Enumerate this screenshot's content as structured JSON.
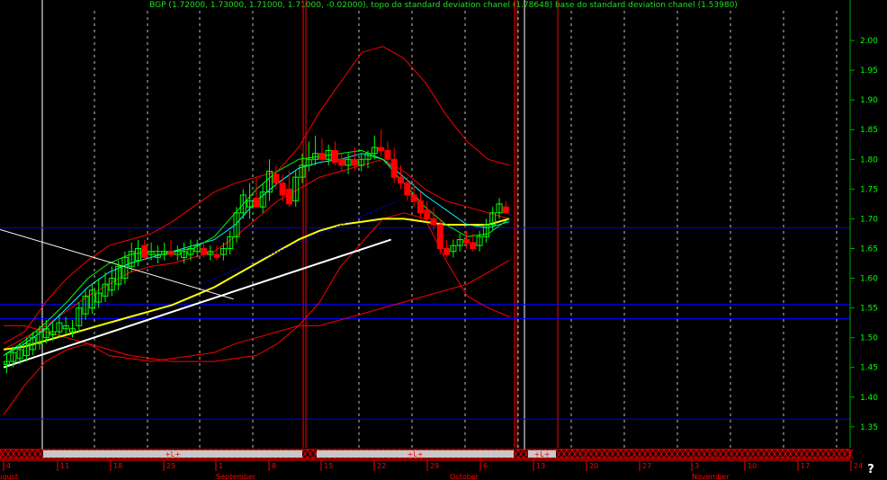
{
  "header": {
    "text": "BGP (1.72000, 1.73000, 1.71000, 1.71000, -0.02000), topo do standard deviation chanel (1.78648) base do standard deviation chanel (1.53980)"
  },
  "colors": {
    "background": "#000000",
    "up_candle": "#00ff00",
    "down_candle": "#ff0000",
    "grid": "#ffffff",
    "axis": "#00aa00",
    "label": "#00ff00",
    "band": "#ff0000",
    "ma_yellow": "#ffff00",
    "ma_cyan": "#00ffff",
    "trend_white": "#ffffff",
    "horizontal_level": "#0000ff",
    "marker_bar": "#c8c8c8"
  },
  "help_label": "?",
  "chart_data": {
    "type": "candlestick",
    "title": "BGP",
    "y_axis": {
      "ticks": [
        "2.00",
        "1.95",
        "1.90",
        "1.85",
        "1.80",
        "1.75",
        "1.70",
        "1.65",
        "1.60",
        "1.55",
        "1.50",
        "1.45",
        "1.40",
        "1.35"
      ],
      "range": [
        1.315,
        2.05
      ]
    },
    "x_axis": {
      "day_labels": [
        "4",
        "11",
        "18",
        "25",
        "1",
        "8",
        "15",
        "22",
        "29",
        "6",
        "13",
        "20",
        "27",
        "3",
        "10",
        "17",
        "24"
      ],
      "month_labels": [
        "August",
        "September",
        "October",
        "November"
      ]
    },
    "marker_labels": [
      "+L+",
      "+L+",
      "+L+"
    ],
    "horizontal_levels": [
      1.685,
      1.556,
      1.532,
      1.363
    ],
    "candles": [
      {
        "o": 1.455,
        "h": 1.475,
        "l": 1.44,
        "c": 1.46
      },
      {
        "o": 1.46,
        "h": 1.485,
        "l": 1.45,
        "c": 1.475
      },
      {
        "o": 1.465,
        "h": 1.49,
        "l": 1.455,
        "c": 1.48
      },
      {
        "o": 1.47,
        "h": 1.5,
        "l": 1.46,
        "c": 1.49
      },
      {
        "o": 1.48,
        "h": 1.51,
        "l": 1.47,
        "c": 1.5
      },
      {
        "o": 1.49,
        "h": 1.52,
        "l": 1.48,
        "c": 1.51
      },
      {
        "o": 1.5,
        "h": 1.53,
        "l": 1.49,
        "c": 1.515
      },
      {
        "o": 1.505,
        "h": 1.525,
        "l": 1.495,
        "c": 1.51
      },
      {
        "o": 1.51,
        "h": 1.54,
        "l": 1.5,
        "c": 1.525
      },
      {
        "o": 1.515,
        "h": 1.535,
        "l": 1.505,
        "c": 1.52
      },
      {
        "o": 1.51,
        "h": 1.53,
        "l": 1.5,
        "c": 1.515
      },
      {
        "o": 1.52,
        "h": 1.56,
        "l": 1.51,
        "c": 1.55
      },
      {
        "o": 1.54,
        "h": 1.58,
        "l": 1.53,
        "c": 1.57
      },
      {
        "o": 1.55,
        "h": 1.59,
        "l": 1.54,
        "c": 1.58
      },
      {
        "o": 1.56,
        "h": 1.6,
        "l": 1.55,
        "c": 1.575
      },
      {
        "o": 1.57,
        "h": 1.61,
        "l": 1.56,
        "c": 1.59
      },
      {
        "o": 1.58,
        "h": 1.62,
        "l": 1.57,
        "c": 1.6
      },
      {
        "o": 1.59,
        "h": 1.63,
        "l": 1.58,
        "c": 1.62
      },
      {
        "o": 1.6,
        "h": 1.645,
        "l": 1.59,
        "c": 1.635
      },
      {
        "o": 1.62,
        "h": 1.66,
        "l": 1.61,
        "c": 1.645
      },
      {
        "o": 1.63,
        "h": 1.665,
        "l": 1.62,
        "c": 1.65
      },
      {
        "o": 1.655,
        "h": 1.665,
        "l": 1.63,
        "c": 1.635
      },
      {
        "o": 1.64,
        "h": 1.66,
        "l": 1.63,
        "c": 1.645
      },
      {
        "o": 1.635,
        "h": 1.655,
        "l": 1.625,
        "c": 1.64
      },
      {
        "o": 1.64,
        "h": 1.66,
        "l": 1.63,
        "c": 1.645
      },
      {
        "o": 1.645,
        "h": 1.665,
        "l": 1.635,
        "c": 1.64
      },
      {
        "o": 1.64,
        "h": 1.655,
        "l": 1.63,
        "c": 1.645
      },
      {
        "o": 1.635,
        "h": 1.66,
        "l": 1.625,
        "c": 1.645
      },
      {
        "o": 1.64,
        "h": 1.665,
        "l": 1.63,
        "c": 1.65
      },
      {
        "o": 1.645,
        "h": 1.665,
        "l": 1.635,
        "c": 1.655
      },
      {
        "o": 1.65,
        "h": 1.66,
        "l": 1.635,
        "c": 1.64
      },
      {
        "o": 1.64,
        "h": 1.655,
        "l": 1.63,
        "c": 1.645
      },
      {
        "o": 1.64,
        "h": 1.655,
        "l": 1.63,
        "c": 1.635
      },
      {
        "o": 1.64,
        "h": 1.66,
        "l": 1.63,
        "c": 1.65
      },
      {
        "o": 1.65,
        "h": 1.68,
        "l": 1.64,
        "c": 1.67
      },
      {
        "o": 1.67,
        "h": 1.72,
        "l": 1.66,
        "c": 1.71
      },
      {
        "o": 1.71,
        "h": 1.75,
        "l": 1.7,
        "c": 1.74
      },
      {
        "o": 1.72,
        "h": 1.76,
        "l": 1.7,
        "c": 1.73
      },
      {
        "o": 1.735,
        "h": 1.77,
        "l": 1.72,
        "c": 1.72
      },
      {
        "o": 1.72,
        "h": 1.76,
        "l": 1.71,
        "c": 1.745
      },
      {
        "o": 1.745,
        "h": 1.8,
        "l": 1.73,
        "c": 1.78
      },
      {
        "o": 1.775,
        "h": 1.79,
        "l": 1.75,
        "c": 1.76
      },
      {
        "o": 1.76,
        "h": 1.775,
        "l": 1.73,
        "c": 1.74
      },
      {
        "o": 1.75,
        "h": 1.78,
        "l": 1.72,
        "c": 1.725
      },
      {
        "o": 1.73,
        "h": 1.78,
        "l": 1.72,
        "c": 1.77
      },
      {
        "o": 1.77,
        "h": 1.81,
        "l": 1.76,
        "c": 1.79
      },
      {
        "o": 1.79,
        "h": 1.83,
        "l": 1.78,
        "c": 1.8
      },
      {
        "o": 1.8,
        "h": 1.84,
        "l": 1.79,
        "c": 1.81
      },
      {
        "o": 1.81,
        "h": 1.835,
        "l": 1.795,
        "c": 1.8
      },
      {
        "o": 1.8,
        "h": 1.825,
        "l": 1.79,
        "c": 1.815
      },
      {
        "o": 1.815,
        "h": 1.83,
        "l": 1.79,
        "c": 1.795
      },
      {
        "o": 1.8,
        "h": 1.81,
        "l": 1.78,
        "c": 1.79
      },
      {
        "o": 1.79,
        "h": 1.81,
        "l": 1.775,
        "c": 1.8
      },
      {
        "o": 1.8,
        "h": 1.82,
        "l": 1.78,
        "c": 1.79
      },
      {
        "o": 1.79,
        "h": 1.81,
        "l": 1.78,
        "c": 1.8
      },
      {
        "o": 1.8,
        "h": 1.815,
        "l": 1.785,
        "c": 1.81
      },
      {
        "o": 1.81,
        "h": 1.84,
        "l": 1.8,
        "c": 1.82
      },
      {
        "o": 1.82,
        "h": 1.85,
        "l": 1.805,
        "c": 1.815
      },
      {
        "o": 1.815,
        "h": 1.83,
        "l": 1.79,
        "c": 1.8
      },
      {
        "o": 1.8,
        "h": 1.82,
        "l": 1.76,
        "c": 1.77
      },
      {
        "o": 1.77,
        "h": 1.79,
        "l": 1.75,
        "c": 1.76
      },
      {
        "o": 1.76,
        "h": 1.77,
        "l": 1.73,
        "c": 1.74
      },
      {
        "o": 1.74,
        "h": 1.76,
        "l": 1.72,
        "c": 1.73
      },
      {
        "o": 1.73,
        "h": 1.745,
        "l": 1.7,
        "c": 1.71
      },
      {
        "o": 1.715,
        "h": 1.73,
        "l": 1.695,
        "c": 1.7
      },
      {
        "o": 1.7,
        "h": 1.72,
        "l": 1.68,
        "c": 1.69
      },
      {
        "o": 1.69,
        "h": 1.7,
        "l": 1.64,
        "c": 1.65
      },
      {
        "o": 1.65,
        "h": 1.665,
        "l": 1.635,
        "c": 1.64
      },
      {
        "o": 1.645,
        "h": 1.665,
        "l": 1.635,
        "c": 1.655
      },
      {
        "o": 1.655,
        "h": 1.675,
        "l": 1.645,
        "c": 1.665
      },
      {
        "o": 1.665,
        "h": 1.68,
        "l": 1.65,
        "c": 1.66
      },
      {
        "o": 1.66,
        "h": 1.675,
        "l": 1.645,
        "c": 1.65
      },
      {
        "o": 1.655,
        "h": 1.68,
        "l": 1.645,
        "c": 1.67
      },
      {
        "o": 1.67,
        "h": 1.7,
        "l": 1.66,
        "c": 1.69
      },
      {
        "o": 1.69,
        "h": 1.72,
        "l": 1.68,
        "c": 1.71
      },
      {
        "o": 1.71,
        "h": 1.735,
        "l": 1.7,
        "c": 1.725
      },
      {
        "o": 1.72,
        "h": 1.73,
        "l": 1.71,
        "c": 1.71
      }
    ],
    "series": [
      {
        "kind": "upper_band",
        "values": [
          1.49,
          1.51,
          1.56,
          1.6,
          1.63,
          1.655,
          1.665,
          1.675,
          1.695,
          1.72,
          1.745,
          1.76,
          1.77,
          1.78,
          1.82,
          1.88,
          1.93,
          1.98,
          1.99,
          1.97,
          1.93,
          1.875,
          1.83,
          1.8,
          1.79
        ]
      },
      {
        "kind": "lower_band",
        "values": [
          1.37,
          1.42,
          1.46,
          1.48,
          1.49,
          1.47,
          1.465,
          1.46,
          1.465,
          1.47,
          1.475,
          1.49,
          1.5,
          1.51,
          1.52,
          1.52,
          1.53,
          1.54,
          1.55,
          1.56,
          1.57,
          1.58,
          1.59,
          1.61,
          1.63
        ]
      },
      {
        "kind": "inner_band_upper",
        "values": [
          1.48,
          1.5,
          1.52,
          1.545,
          1.57,
          1.59,
          1.61,
          1.62,
          1.625,
          1.635,
          1.645,
          1.67,
          1.7,
          1.73,
          1.75,
          1.77,
          1.78,
          1.79,
          1.8,
          1.78,
          1.75,
          1.73,
          1.72,
          1.71,
          1.7
        ]
      },
      {
        "kind": "inner_band_lower",
        "values": [
          1.52,
          1.52,
          1.51,
          1.5,
          1.49,
          1.48,
          1.47,
          1.465,
          1.46,
          1.46,
          1.46,
          1.465,
          1.47,
          1.49,
          1.52,
          1.56,
          1.62,
          1.66,
          1.7,
          1.71,
          1.7,
          1.63,
          1.57,
          1.55,
          1.535
        ]
      },
      {
        "kind": "ma_yellow",
        "values": [
          1.48,
          1.485,
          1.495,
          1.505,
          1.515,
          1.525,
          1.535,
          1.545,
          1.555,
          1.57,
          1.585,
          1.605,
          1.625,
          1.645,
          1.665,
          1.68,
          1.69,
          1.695,
          1.7,
          1.7,
          1.695,
          1.69,
          1.69,
          1.69,
          1.7
        ]
      },
      {
        "kind": "ma_cyan",
        "values": [
          1.47,
          1.49,
          1.515,
          1.55,
          1.585,
          1.61,
          1.625,
          1.635,
          1.645,
          1.655,
          1.665,
          1.69,
          1.73,
          1.76,
          1.785,
          1.795,
          1.8,
          1.81,
          1.8,
          1.77,
          1.74,
          1.715,
          1.69,
          1.685,
          1.695
        ]
      },
      {
        "kind": "ma_green",
        "values": [
          1.47,
          1.495,
          1.525,
          1.56,
          1.6,
          1.625,
          1.64,
          1.645,
          1.645,
          1.65,
          1.67,
          1.71,
          1.75,
          1.78,
          1.8,
          1.805,
          1.81,
          1.815,
          1.8,
          1.76,
          1.72,
          1.69,
          1.67,
          1.675,
          1.7
        ]
      }
    ],
    "trend_lines": [
      {
        "color": "white",
        "from": [
          0,
          1.45
        ],
        "to": [
          59,
          1.665
        ]
      },
      {
        "color": "white",
        "from": [
          -3,
          1.69
        ],
        "to": [
          35,
          1.565
        ]
      },
      {
        "color": "blue_dashed",
        "from": [
          30,
          1.59
        ],
        "to": [
          60,
          1.73
        ]
      }
    ]
  }
}
